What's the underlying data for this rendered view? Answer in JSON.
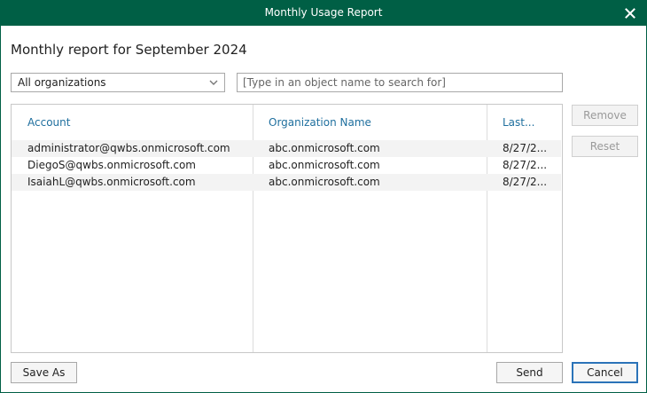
{
  "window": {
    "title": "Monthly Usage Report"
  },
  "heading": "Monthly report for September 2024",
  "filters": {
    "organization_selected": "All organizations",
    "search_placeholder": "[Type in an object name to search for]"
  },
  "table": {
    "columns": [
      "Account",
      "Organization Name",
      "Last..."
    ],
    "rows": [
      {
        "account": "administrator@qwbs.onmicrosoft.com",
        "organization": "abc.onmicrosoft.com",
        "last": "8/27/2..."
      },
      {
        "account": "DiegoS@qwbs.onmicrosoft.com",
        "organization": "abc.onmicrosoft.com",
        "last": "8/27/2..."
      },
      {
        "account": "IsaiahL@qwbs.onmicrosoft.com",
        "organization": "abc.onmicrosoft.com",
        "last": "8/27/2..."
      }
    ]
  },
  "side_buttons": {
    "remove": "Remove",
    "reset": "Reset"
  },
  "footer": {
    "save_as": "Save As",
    "send": "Send",
    "cancel": "Cancel"
  },
  "colors": {
    "titlebar": "#005f45",
    "header_text": "#1f6f9e",
    "focus_border": "#2b73b8"
  }
}
